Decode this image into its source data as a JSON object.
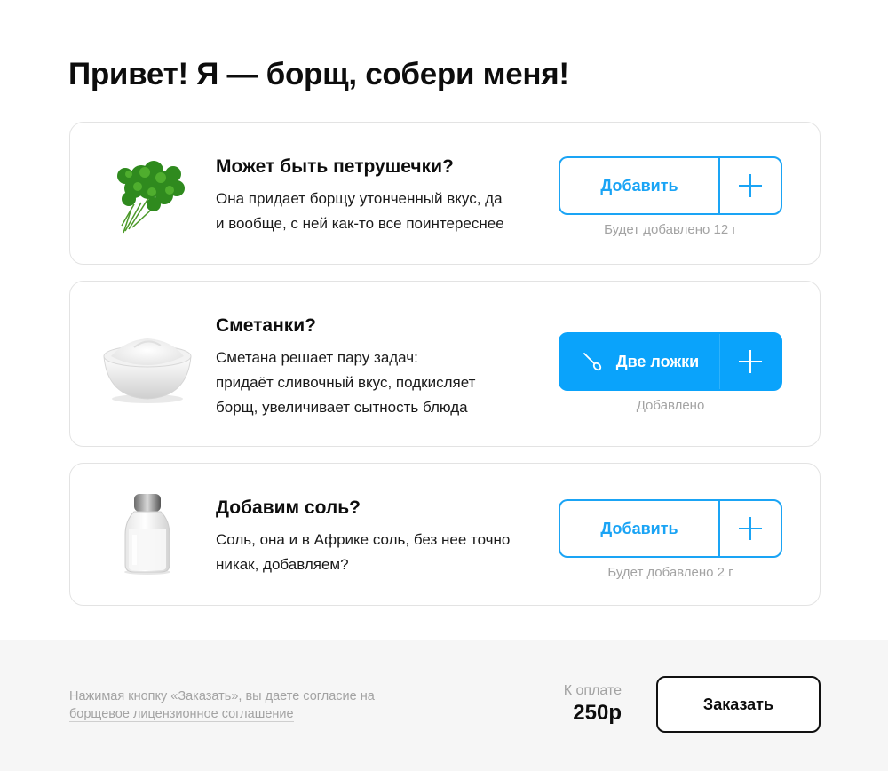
{
  "page": {
    "title": "Привет! Я — борщ, собери меня!"
  },
  "items": [
    {
      "title": "Может быть петрушечки?",
      "desc_lines": [
        "Она придает борщу утонченный вкус, да",
        "и вообще, с ней как-то все поинтереснее"
      ],
      "button_label": "Добавить",
      "status": "Будет добавлено 12 г",
      "image": "parsley-image",
      "added": false
    },
    {
      "title": "Сметанки?",
      "desc_lines": [
        "Сметана решает пару задач:",
        "придаёт сливочный вкус, подкисляет",
        "борщ, увеличивает сытность блюда"
      ],
      "button_label": "Две ложки",
      "status": "Добавлено",
      "image": "sour-cream-image",
      "button_icon": "spoon-icon",
      "added": true
    },
    {
      "title": "Добавим соль?",
      "desc_lines": [
        "Соль, она и в Африке соль, без нее точно",
        "никак, добавляем?"
      ],
      "button_label": "Добавить",
      "status": "Будет добавлено 2 г",
      "image": "salt-shaker-image",
      "added": false
    }
  ],
  "footer": {
    "consent_prefix": "Нажимая кнопку «Заказать», вы даете согласие на",
    "consent_link": "борщевое лицензионное соглашение",
    "pay_label": "К оплате",
    "pay_amount": "250р",
    "order_button": "Заказать"
  },
  "colors": {
    "accent": "#1aa4f5",
    "accent_active": "#0aa3fb",
    "muted_text": "#a3a3a3",
    "footer_bg": "#f6f6f6"
  }
}
